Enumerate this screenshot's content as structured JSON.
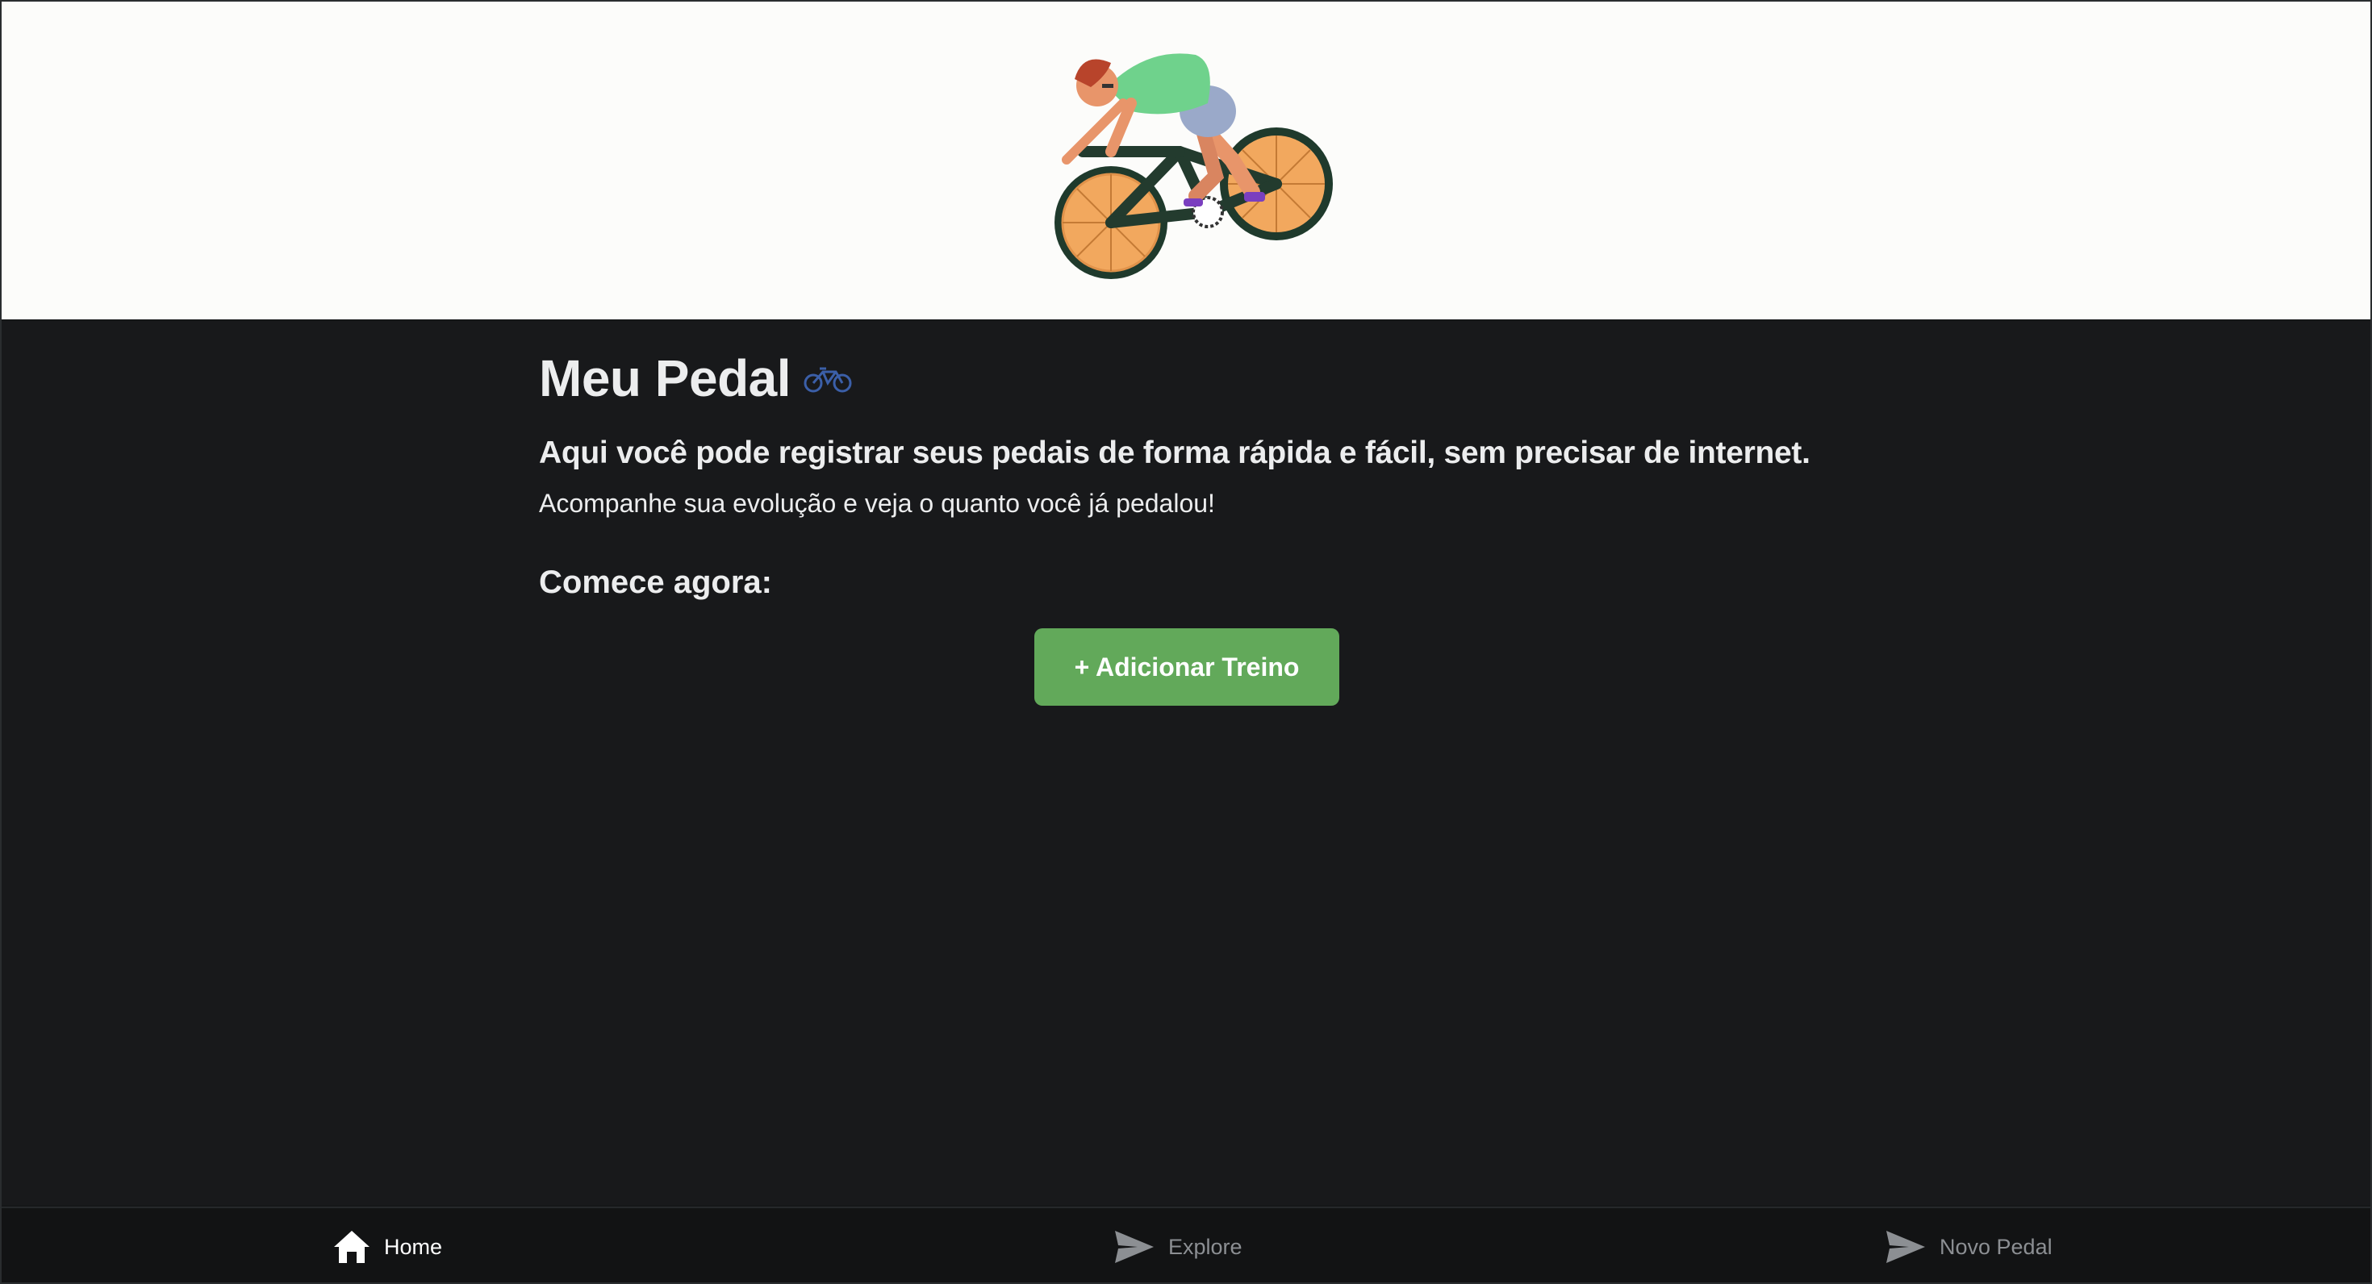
{
  "header": {
    "illustration": "cyclist-illustration"
  },
  "main": {
    "title": "Meu Pedal",
    "title_icon": "bicycle-icon",
    "subtitle": "Aqui você pode registrar seus pedais de forma rápida e fácil, sem precisar de internet.",
    "description": "Acompanhe sua evolução e veja o quanto você já pedalou!",
    "start_label": "Comece agora:",
    "add_button_label": "+ Adicionar Treino",
    "accent_color": "#62A95A"
  },
  "tabbar": {
    "tabs": [
      {
        "label": "Home",
        "icon": "home-icon",
        "active": true
      },
      {
        "label": "Explore",
        "icon": "paper-plane-icon",
        "active": false
      },
      {
        "label": "Novo Pedal",
        "icon": "paper-plane-icon",
        "active": false
      }
    ]
  }
}
